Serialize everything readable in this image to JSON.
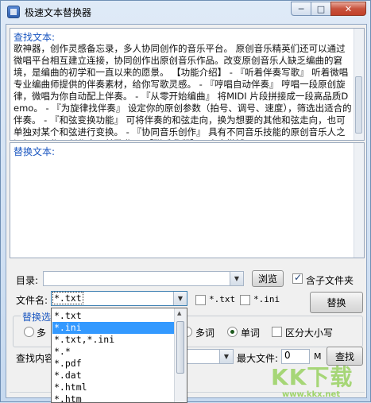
{
  "window": {
    "title": "极速文本替换器",
    "min_glyph": "─",
    "max_glyph": "□",
    "close_glyph": "✕"
  },
  "find": {
    "label": "查找文本:",
    "text": "歌神器，创作灵感备忘录，多人协同创作的音乐平台。 原创音乐精英们还可以通过微唱平台相互建立连接，协同创作出原创音乐作品。改变原创音乐人缺乏编曲的窘境，是编曲的初学和一直以来的愿景。 【功能介绍】 - 『听着伴奏写歌』 听着微唱专业编曲师提供的伴奏素材，给你写歌灵感。 - 『哼唱自动伴奏』 哼唱一段原创旋律，微唱为你自动配上伴奏。 - 『从零开始编曲』 将MIDI 片段拼接成一段高品质Demo。 - 『为旋律找伴奏』 设定你的原创参数（拍号、调号、速度），筛选出适合的伴奏。 - 『和弦变换功能』 可将伴奏的和弦走向，换为想要的其他和弦走向，也可单独对某个和弦进行变换。 - 『协同音乐创作』 具有不同音乐技能的原创音乐人之间相互合作，创作出一首歌曲。 【联系我们】 - 官方微博:"
  },
  "replace": {
    "label": "替换文本:",
    "text": ""
  },
  "directory": {
    "label": "目录:",
    "value": "",
    "browse_label": "浏览",
    "include_subdirs_label": "含子文件夹",
    "include_subdirs_checked": true
  },
  "filename": {
    "label": "文件名:",
    "value": "*.txt",
    "quick_txt_label": "*.txt",
    "quick_ini_label": "*.ini",
    "options": [
      "*.txt",
      "*.ini",
      "*.txt,*.ini",
      "*.*",
      "*.pdf",
      "*.dat",
      "*.html",
      "*.htm"
    ],
    "selected_index": 1
  },
  "replace_button": "替换",
  "options_group": {
    "label": "替换选",
    "multi_label": "多",
    "multiword_label": "多词",
    "singleword_label": "单词",
    "singleword_checked": true,
    "case_label": "区分大小写",
    "case_checked": false
  },
  "search": {
    "label": "查找内容",
    "maxfile_label": "最大文件:",
    "maxfile_value": "0",
    "unit": "M",
    "button_label": "查找"
  },
  "watermark": {
    "text": "KK下载",
    "url": "www.kkx.net"
  }
}
